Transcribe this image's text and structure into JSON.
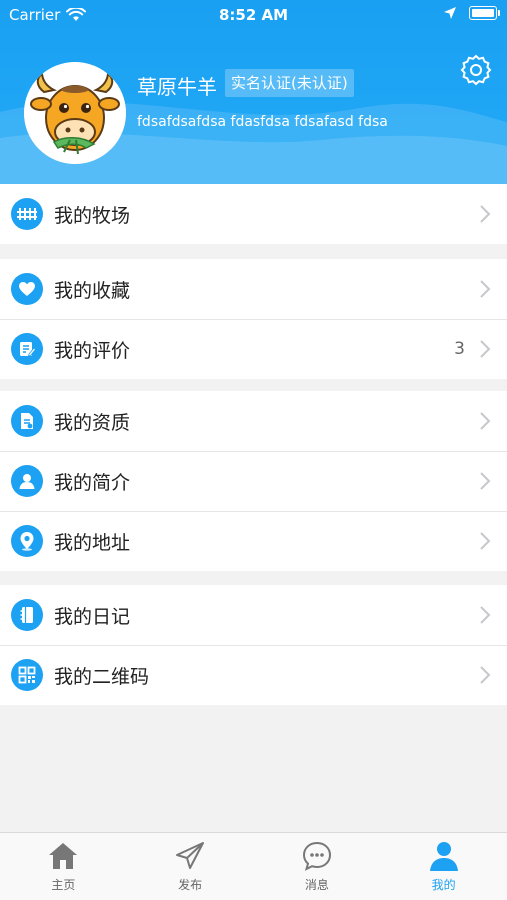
{
  "status_bar": {
    "carrier": "Carrier",
    "time": "8:52 AM"
  },
  "profile": {
    "name": "草原牛羊",
    "verification": "实名认证(未认证)",
    "bio": "fdsafdsafdsa fdasfdsa fdsafasd fdsa"
  },
  "menu_groups": [
    {
      "items": [
        {
          "icon": "ranch-icon",
          "label": "我的牧场"
        }
      ]
    },
    {
      "items": [
        {
          "icon": "heart-icon",
          "label": "我的收藏"
        },
        {
          "icon": "review-icon",
          "label": "我的评价",
          "badge": "3"
        }
      ]
    },
    {
      "items": [
        {
          "icon": "certificate-icon",
          "label": "我的资质"
        },
        {
          "icon": "person-icon",
          "label": "我的简介"
        },
        {
          "icon": "location-pin-icon",
          "label": "我的地址"
        }
      ]
    },
    {
      "items": [
        {
          "icon": "diary-icon",
          "label": "我的日记"
        },
        {
          "icon": "qr-code-icon",
          "label": "我的二维码"
        }
      ]
    }
  ],
  "tabbar": {
    "items": [
      {
        "icon": "home-icon",
        "label": "主页"
      },
      {
        "icon": "send-icon",
        "label": "发布"
      },
      {
        "icon": "message-icon",
        "label": "消息"
      },
      {
        "icon": "user-icon",
        "label": "我的"
      }
    ],
    "active_index": 3
  },
  "colors": {
    "accent": "#1da1f2",
    "header": "#22a9f5",
    "inactive": "#666666"
  }
}
